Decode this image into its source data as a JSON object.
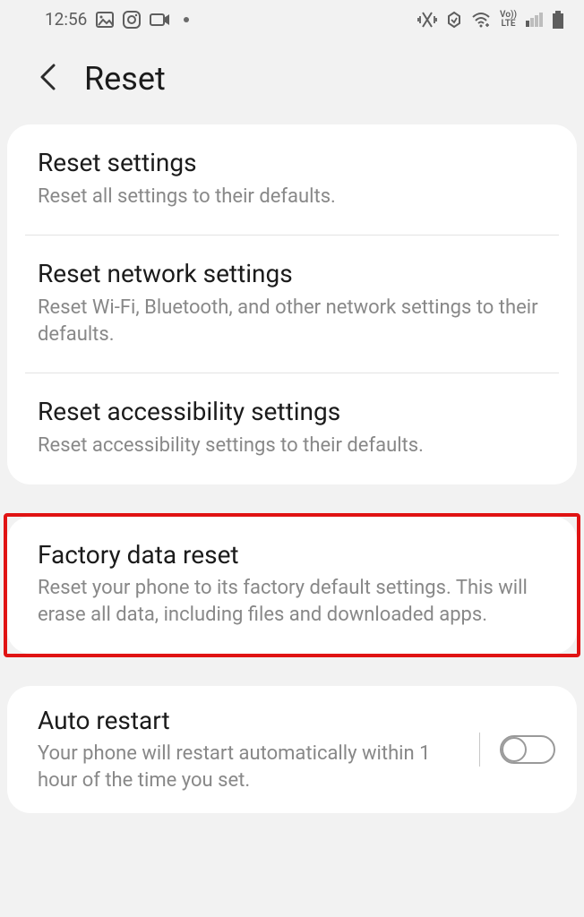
{
  "status": {
    "time": "12:56",
    "volte_top": "Vo))",
    "volte_bottom": "LTE"
  },
  "header": {
    "title": "Reset"
  },
  "group1": {
    "items": [
      {
        "title": "Reset settings",
        "desc": "Reset all settings to their defaults."
      },
      {
        "title": "Reset network settings",
        "desc": "Reset Wi-Fi, Bluetooth, and other network settings to their defaults."
      },
      {
        "title": "Reset accessibility settings",
        "desc": "Reset accessibility settings to their defaults."
      }
    ]
  },
  "factory": {
    "title": "Factory data reset",
    "desc": "Reset your phone to its factory default settings. This will erase all data, including files and downloaded apps."
  },
  "auto_restart": {
    "title": "Auto restart",
    "desc": "Your phone will restart automatically within 1 hour of the time you set."
  }
}
